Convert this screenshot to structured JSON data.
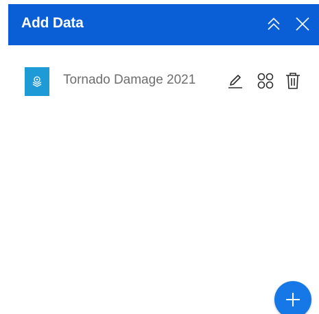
{
  "header": {
    "title": "Add Data",
    "collapse_icon": "double-chevron-up-icon",
    "close_icon": "close-icon"
  },
  "data_list": {
    "items": [
      {
        "title": "Tornado Damage 2021",
        "thumbnail_icon": "feature-layer-icon",
        "actions": [
          "pencil-icon",
          "settings-grid-icon",
          "trash-icon"
        ]
      }
    ]
  },
  "fab": {
    "icon": "plus-icon"
  },
  "colors": {
    "header_bg": "#0a5fd6",
    "thumb_bg": "#1e9ad6",
    "fab_bg": "#1578e6",
    "text_muted": "#6e6e6e"
  }
}
